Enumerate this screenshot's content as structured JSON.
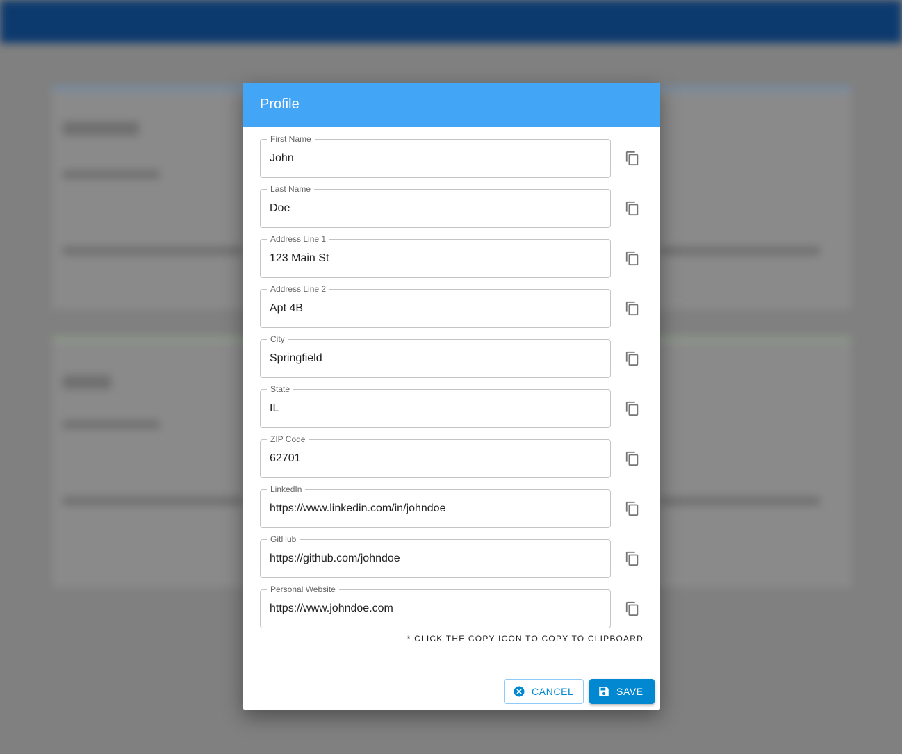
{
  "dialog": {
    "title": "Profile",
    "fields": [
      {
        "label": "First Name",
        "value": "John"
      },
      {
        "label": "Last Name",
        "value": "Doe"
      },
      {
        "label": "Address Line 1",
        "value": "123 Main St"
      },
      {
        "label": "Address Line 2",
        "value": "Apt 4B"
      },
      {
        "label": "City",
        "value": "Springfield"
      },
      {
        "label": "State",
        "value": "IL"
      },
      {
        "label": "ZIP Code",
        "value": "62701"
      },
      {
        "label": "LinkedIn",
        "value": "https://www.linkedin.com/in/johndoe"
      },
      {
        "label": "GitHub",
        "value": "https://github.com/johndoe"
      },
      {
        "label": "Personal Website",
        "value": "https://www.johndoe.com"
      }
    ],
    "hint": "* CLICK THE COPY ICON TO COPY TO CLIPBOARD",
    "cancel_label": "CANCEL",
    "save_label": "SAVE"
  },
  "colors": {
    "header": "#42a5f5",
    "primary": "#0288d1",
    "appbar": "#0d3a6e"
  }
}
